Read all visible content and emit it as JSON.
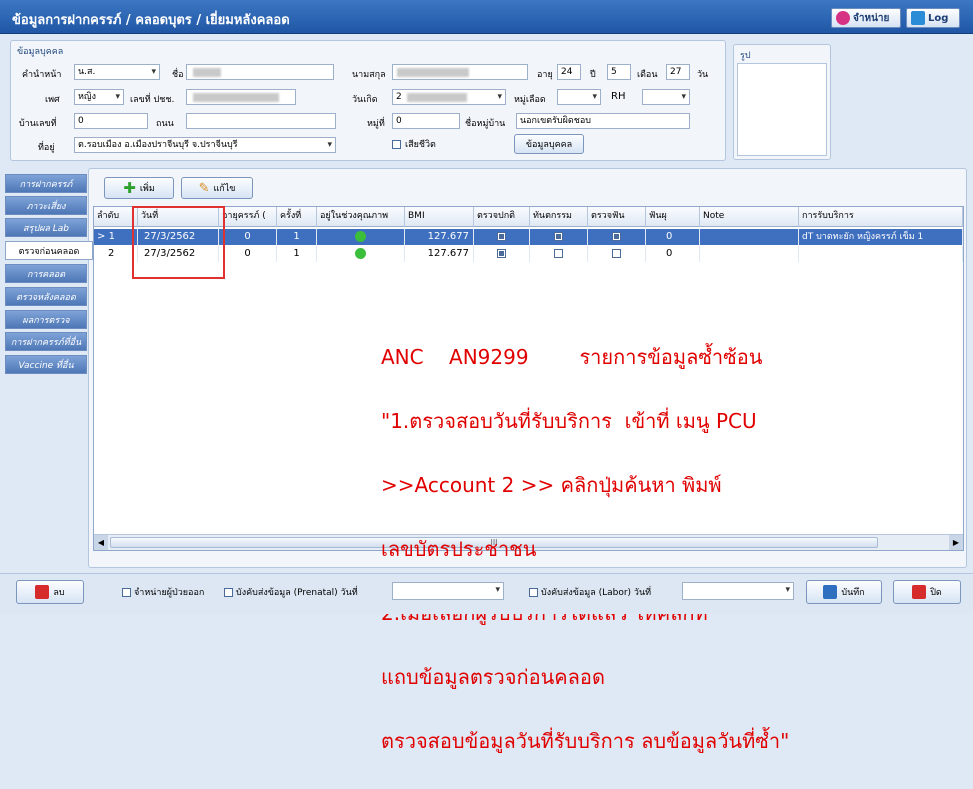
{
  "window": {
    "title": "ข้อมูลการฝากครรภ์ / คลอดบุตร / เยี่ยมหลังคลอด",
    "btn_discharge": "จำหน่าย",
    "btn_log": "Log"
  },
  "person": {
    "section_title": "ข้อมูลบุคคล",
    "prefix_label": "คำนำหน้า",
    "prefix_value": "น.ส.",
    "name_label": "ชื่อ",
    "surname_label": "นามสกุล",
    "age_label": "อายุ",
    "age_years": "24",
    "years_unit": "ปี",
    "age_months": "5",
    "months_unit": "เดือน",
    "age_days": "27",
    "days_unit": "วัน",
    "sex_label": "เพศ",
    "sex_value": "หญิง",
    "cid_label": "เลขที่ ปชช.",
    "dob_label": "วันเกิด",
    "dob_value": "2",
    "blood_label": "หมู่เลือด",
    "rh_label": "RH",
    "house_label": "บ้านเลขที่",
    "house_value": "0",
    "road_label": "ถนน",
    "moo_label": "หมู่ที่",
    "moo_value": "0",
    "village_label": "ชื่อหมู่บ้าน",
    "village_value": "นอกเขตรับผิดชอบ",
    "address_label": "ที่อยู่",
    "address_value": "ต.รอบเมือง อ.เมืองปราจีนบุรี จ.ปราจีนบุรี",
    "deceased_label": "เสียชีวิต",
    "person_btn": "ข้อมูลบุคคล"
  },
  "photo": {
    "title": "รูป"
  },
  "tabs": [
    "การฝากครรภ์",
    "ภาวะเสี่ยง",
    "สรุปผล Lab",
    "ตรวจก่อนคลอด",
    "การคลอด",
    "ตรวจหลังคลอด",
    "ผลการตรวจ",
    "การฝากครรภ์ที่อื่น",
    "Vaccine ที่อื่น"
  ],
  "toolbar": {
    "add": "เพิ่ม",
    "edit": "แก้ไข"
  },
  "grid": {
    "columns": [
      "ลำดับ",
      "วันที่",
      "อายุครรภ์ (",
      "ครั้งที่",
      "อยู่ในช่วงคุณภาพ",
      "BMI",
      "ตรวจปกติ",
      "ทันตกรรม",
      "ตรวจฟัน",
      "ฟันผุ",
      "Note",
      "การรับบริการ"
    ],
    "rows": [
      {
        "seq": "1",
        "date": "27/3/2562",
        "ga": "0",
        "visit": "1",
        "bmi": "127.677",
        "normal": true,
        "dental": true,
        "teeth": true,
        "decay": "0",
        "note": "",
        "service": "dT บาดทะยัก หญิงครรภ์ เข็ม 1"
      },
      {
        "seq": "2",
        "date": "27/3/2562",
        "ga": "0",
        "visit": "1",
        "bmi": "127.677",
        "normal": true,
        "dental": false,
        "teeth": false,
        "decay": "0",
        "note": "",
        "service": ""
      }
    ],
    "scroll_mark": "III"
  },
  "annotation": {
    "line1": "ANC    AN9299        รายการข้อมูลซ้ำซ้อน",
    "line2": "\"1.ตรวจสอบวันที่รับบริการ  เข้าที่ เมนู PCU",
    ">>line3": "",
    "line3": ">>Account 2 >> คลิกปุ่มค้นหา พิมพ์",
    "line4": "เลขบัตรประชาชน",
    "line5": "2.เมื่อเลือกผู้รับบริการได้แล้ว ให้คลิกที่",
    "line6": "แถบข้อมูลตรวจก่อนคลอด",
    "line7": "ตรวจสอบข้อมูลวันที่รับบริการ ลบข้อมูลวันที่ซ้ำ\""
  },
  "bottom": {
    "delete": "ลบ",
    "discharge_dead": "จำหน่ายผู้ป่วยออก",
    "force_prenatal": "บังคับส่งข้อมูล (Prenatal) วันที่",
    "force_labor": "บังคับส่งข้อมูล (Labor) วันที่",
    "save": "บันทึก",
    "close": "ปิด"
  },
  "colors": {
    "title_bg": "#2a62b0",
    "tab_bg": "#5a82c0",
    "selected_row": "#3f6fbf",
    "annotation": "#e00000",
    "highlight_box": "#e03030"
  }
}
